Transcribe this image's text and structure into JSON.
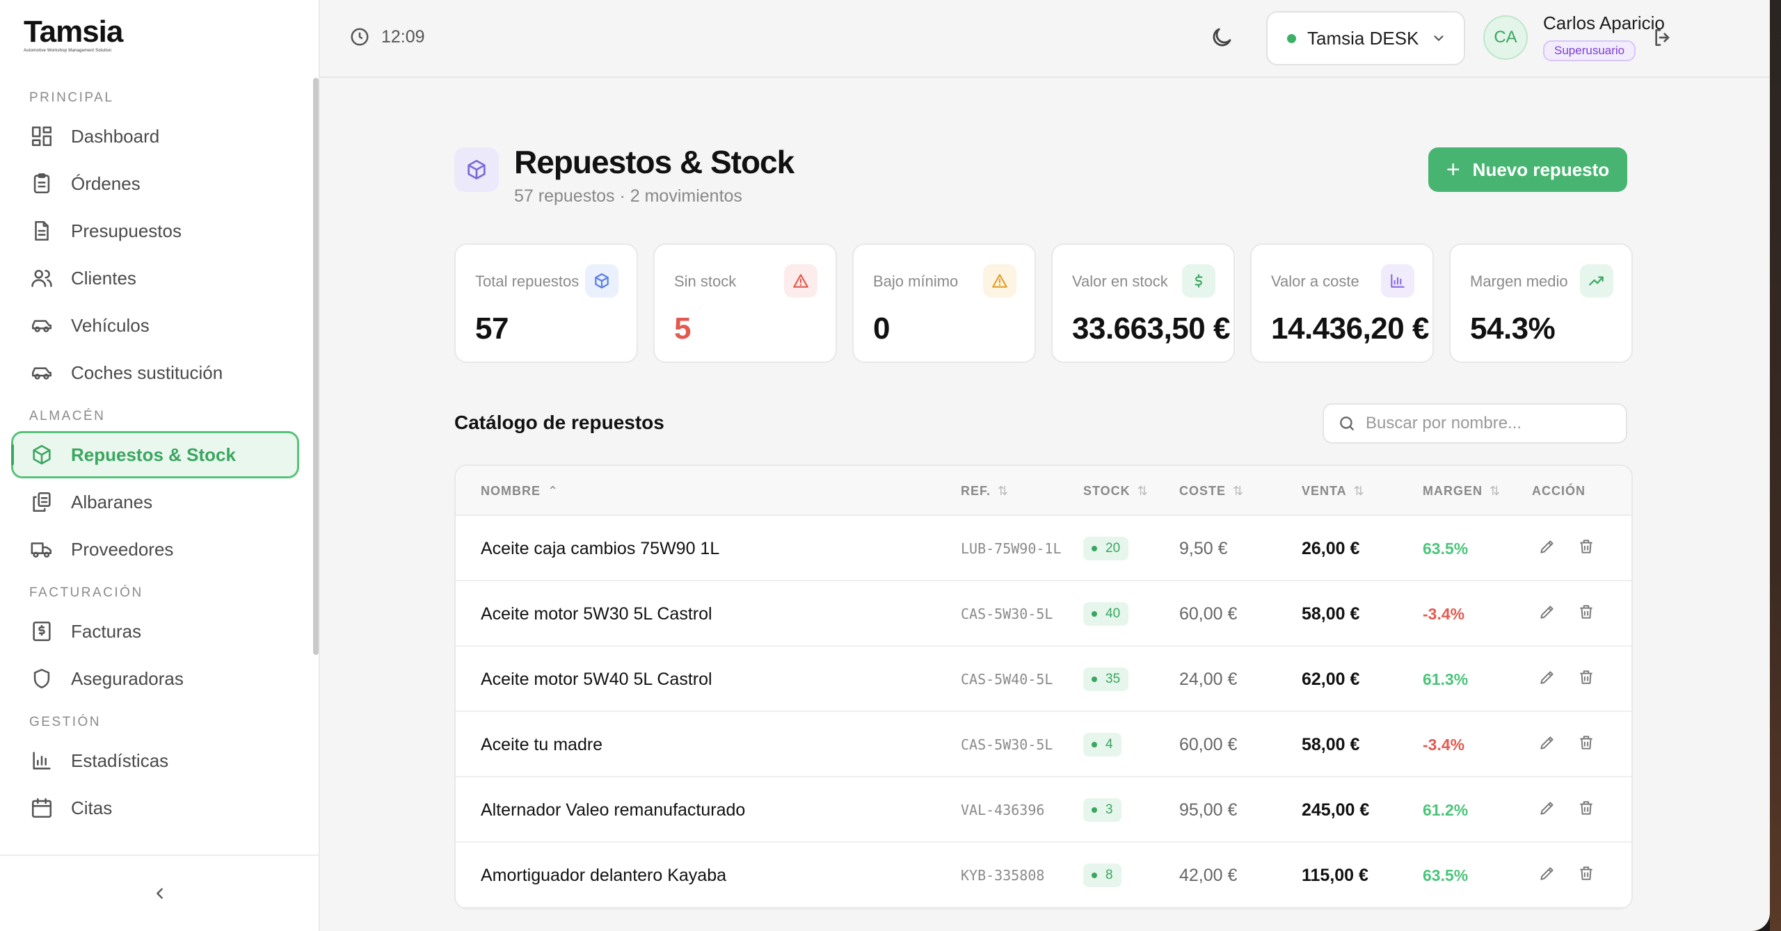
{
  "app": {
    "logo": "Tamsia",
    "logo_tagline": "Automotive Workshop Management Solution"
  },
  "sidebar": {
    "sections": [
      {
        "title": "PRINCIPAL",
        "items": [
          {
            "label": "Dashboard",
            "icon": "dashboard-icon"
          },
          {
            "label": "Órdenes",
            "icon": "clipboard-icon"
          },
          {
            "label": "Presupuestos",
            "icon": "document-icon"
          },
          {
            "label": "Clientes",
            "icon": "users-icon"
          },
          {
            "label": "Vehículos",
            "icon": "car-icon"
          },
          {
            "label": "Coches sustitución",
            "icon": "car-icon"
          }
        ]
      },
      {
        "title": "ALMACÉN",
        "items": [
          {
            "label": "Repuestos & Stock",
            "icon": "box-icon",
            "active": true
          },
          {
            "label": "Albaranes",
            "icon": "copy-icon"
          },
          {
            "label": "Proveedores",
            "icon": "truck-icon"
          }
        ]
      },
      {
        "title": "FACTURACIÓN",
        "items": [
          {
            "label": "Facturas",
            "icon": "invoice-icon"
          },
          {
            "label": "Aseguradoras",
            "icon": "shield-icon"
          }
        ]
      },
      {
        "title": "GESTIÓN",
        "items": [
          {
            "label": "Estadísticas",
            "icon": "bar-chart-icon"
          },
          {
            "label": "Citas",
            "icon": "calendar-icon"
          }
        ]
      }
    ]
  },
  "topbar": {
    "time": "12:09",
    "workspace": "Tamsia DESK",
    "user_initials": "CA",
    "user_name": "Carlos Aparicio",
    "user_role": "Superusuario"
  },
  "page": {
    "title": "Repuestos & Stock",
    "subtitle": "57 repuestos · 2 movimientos",
    "new_button": "Nuevo repuesto"
  },
  "stats": [
    {
      "label": "Total repuestos",
      "value": "57",
      "icon": "box-icon",
      "tone": "#5b7fe0",
      "bg": "#eaf0fc",
      "value_color": "#111111"
    },
    {
      "label": "Sin stock",
      "value": "5",
      "icon": "alert-triangle-icon",
      "tone": "#e25a4f",
      "bg": "#fdecec",
      "value_color": "#e25a4f"
    },
    {
      "label": "Bajo mínimo",
      "value": "0",
      "icon": "alert-triangle-icon",
      "tone": "#e0a22a",
      "bg": "#fdf4e3",
      "value_color": "#111111"
    },
    {
      "label": "Valor en stock",
      "value": "33.663,50 €",
      "icon": "dollar-icon",
      "tone": "#3aa65f",
      "bg": "#e6f6ec",
      "value_color": "#111111"
    },
    {
      "label": "Valor a coste",
      "value": "14.436,20 €",
      "icon": "bar-chart-icon",
      "tone": "#8a6ae0",
      "bg": "#f0ecfc",
      "value_color": "#111111"
    },
    {
      "label": "Margen medio",
      "value": "54.3%",
      "icon": "trending-up-icon",
      "tone": "#3aa65f",
      "bg": "#e6f6ec",
      "value_color": "#111111"
    }
  ],
  "catalog": {
    "title": "Catálogo de repuestos",
    "search_placeholder": "Buscar por nombre...",
    "columns": [
      "NOMBRE",
      "REF.",
      "STOCK",
      "COSTE",
      "VENTA",
      "MARGEN",
      "ACCIÓN"
    ],
    "rows": [
      {
        "name": "Aceite caja cambios 75W90 1L",
        "ref": "LUB-75W90-1L",
        "stock": "20",
        "cost": "9,50 €",
        "sale": "26,00 €",
        "margin": "63.5%",
        "positive": true
      },
      {
        "name": "Aceite motor 5W30 5L Castrol",
        "ref": "CAS-5W30-5L",
        "stock": "40",
        "cost": "60,00 €",
        "sale": "58,00 €",
        "margin": "-3.4%",
        "positive": false
      },
      {
        "name": "Aceite motor 5W40 5L Castrol",
        "ref": "CAS-5W40-5L",
        "stock": "35",
        "cost": "24,00 €",
        "sale": "62,00 €",
        "margin": "61.3%",
        "positive": true
      },
      {
        "name": "Aceite tu madre",
        "ref": "CAS-5W30-5L",
        "stock": "4",
        "cost": "60,00 €",
        "sale": "58,00 €",
        "margin": "-3.4%",
        "positive": false
      },
      {
        "name": "Alternador Valeo remanufacturado",
        "ref": "VAL-436396",
        "stock": "3",
        "cost": "95,00 €",
        "sale": "245,00 €",
        "margin": "61.2%",
        "positive": true
      },
      {
        "name": "Amortiguador delantero Kayaba",
        "ref": "KYB-335808",
        "stock": "8",
        "cost": "42,00 €",
        "sale": "115,00 €",
        "margin": "63.5%",
        "positive": true
      }
    ]
  }
}
